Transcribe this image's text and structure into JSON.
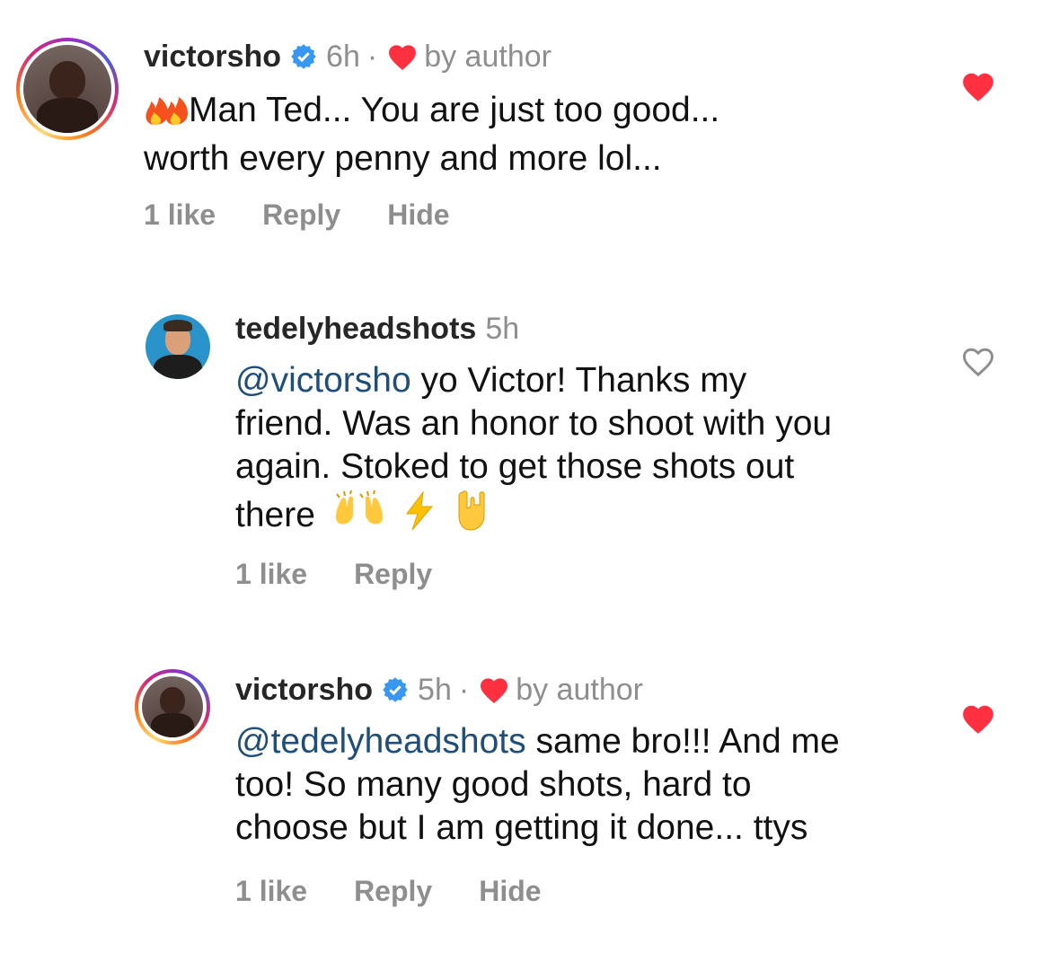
{
  "comments": [
    {
      "username": "victorsho",
      "time": "6h",
      "separator": "·",
      "liked_by": "by author",
      "verified": true,
      "text_prefix_emoji": "🔥🔥",
      "text": "Man Ted... You are just too good...",
      "text_line2": "worth every penny and more lol...",
      "likes": "1 like",
      "reply_label": "Reply",
      "hide_label": "Hide",
      "liked": true
    },
    {
      "username": "tedelyheadshots",
      "time": "5h",
      "mention": "@victorsho",
      "text_line1_rest": " yo Victor! Thanks my",
      "text_line2": "friend. Was an honor to shoot with you",
      "text_line3": "again. Stoked to get those shots out",
      "text_line4": "there",
      "trailing_emoji": "🙌⚡🤘",
      "likes": "1 like",
      "reply_label": "Reply",
      "liked": false
    },
    {
      "username": "victorsho",
      "time": "5h",
      "separator": "·",
      "liked_by": "by author",
      "verified": true,
      "mention": "@tedelyheadshots",
      "text_line1_rest": " same bro!!! And me",
      "text_line2": "too! So many good shots, hard to",
      "text_line3": "choose but I am getting it done... ttys",
      "likes": "1 like",
      "reply_label": "Reply",
      "hide_label": "Hide",
      "liked": true
    }
  ],
  "colors": {
    "heart_red": "#ff3040",
    "verified_blue": "#3897f0",
    "mention_blue": "#1e4e79",
    "secondary_gray": "#8e8e8e"
  },
  "icons": [
    "verified-badge-icon",
    "heart-filled-icon",
    "heart-outline-icon",
    "fire-emoji",
    "raised-hands-emoji",
    "lightning-emoji",
    "rock-on-emoji"
  ]
}
